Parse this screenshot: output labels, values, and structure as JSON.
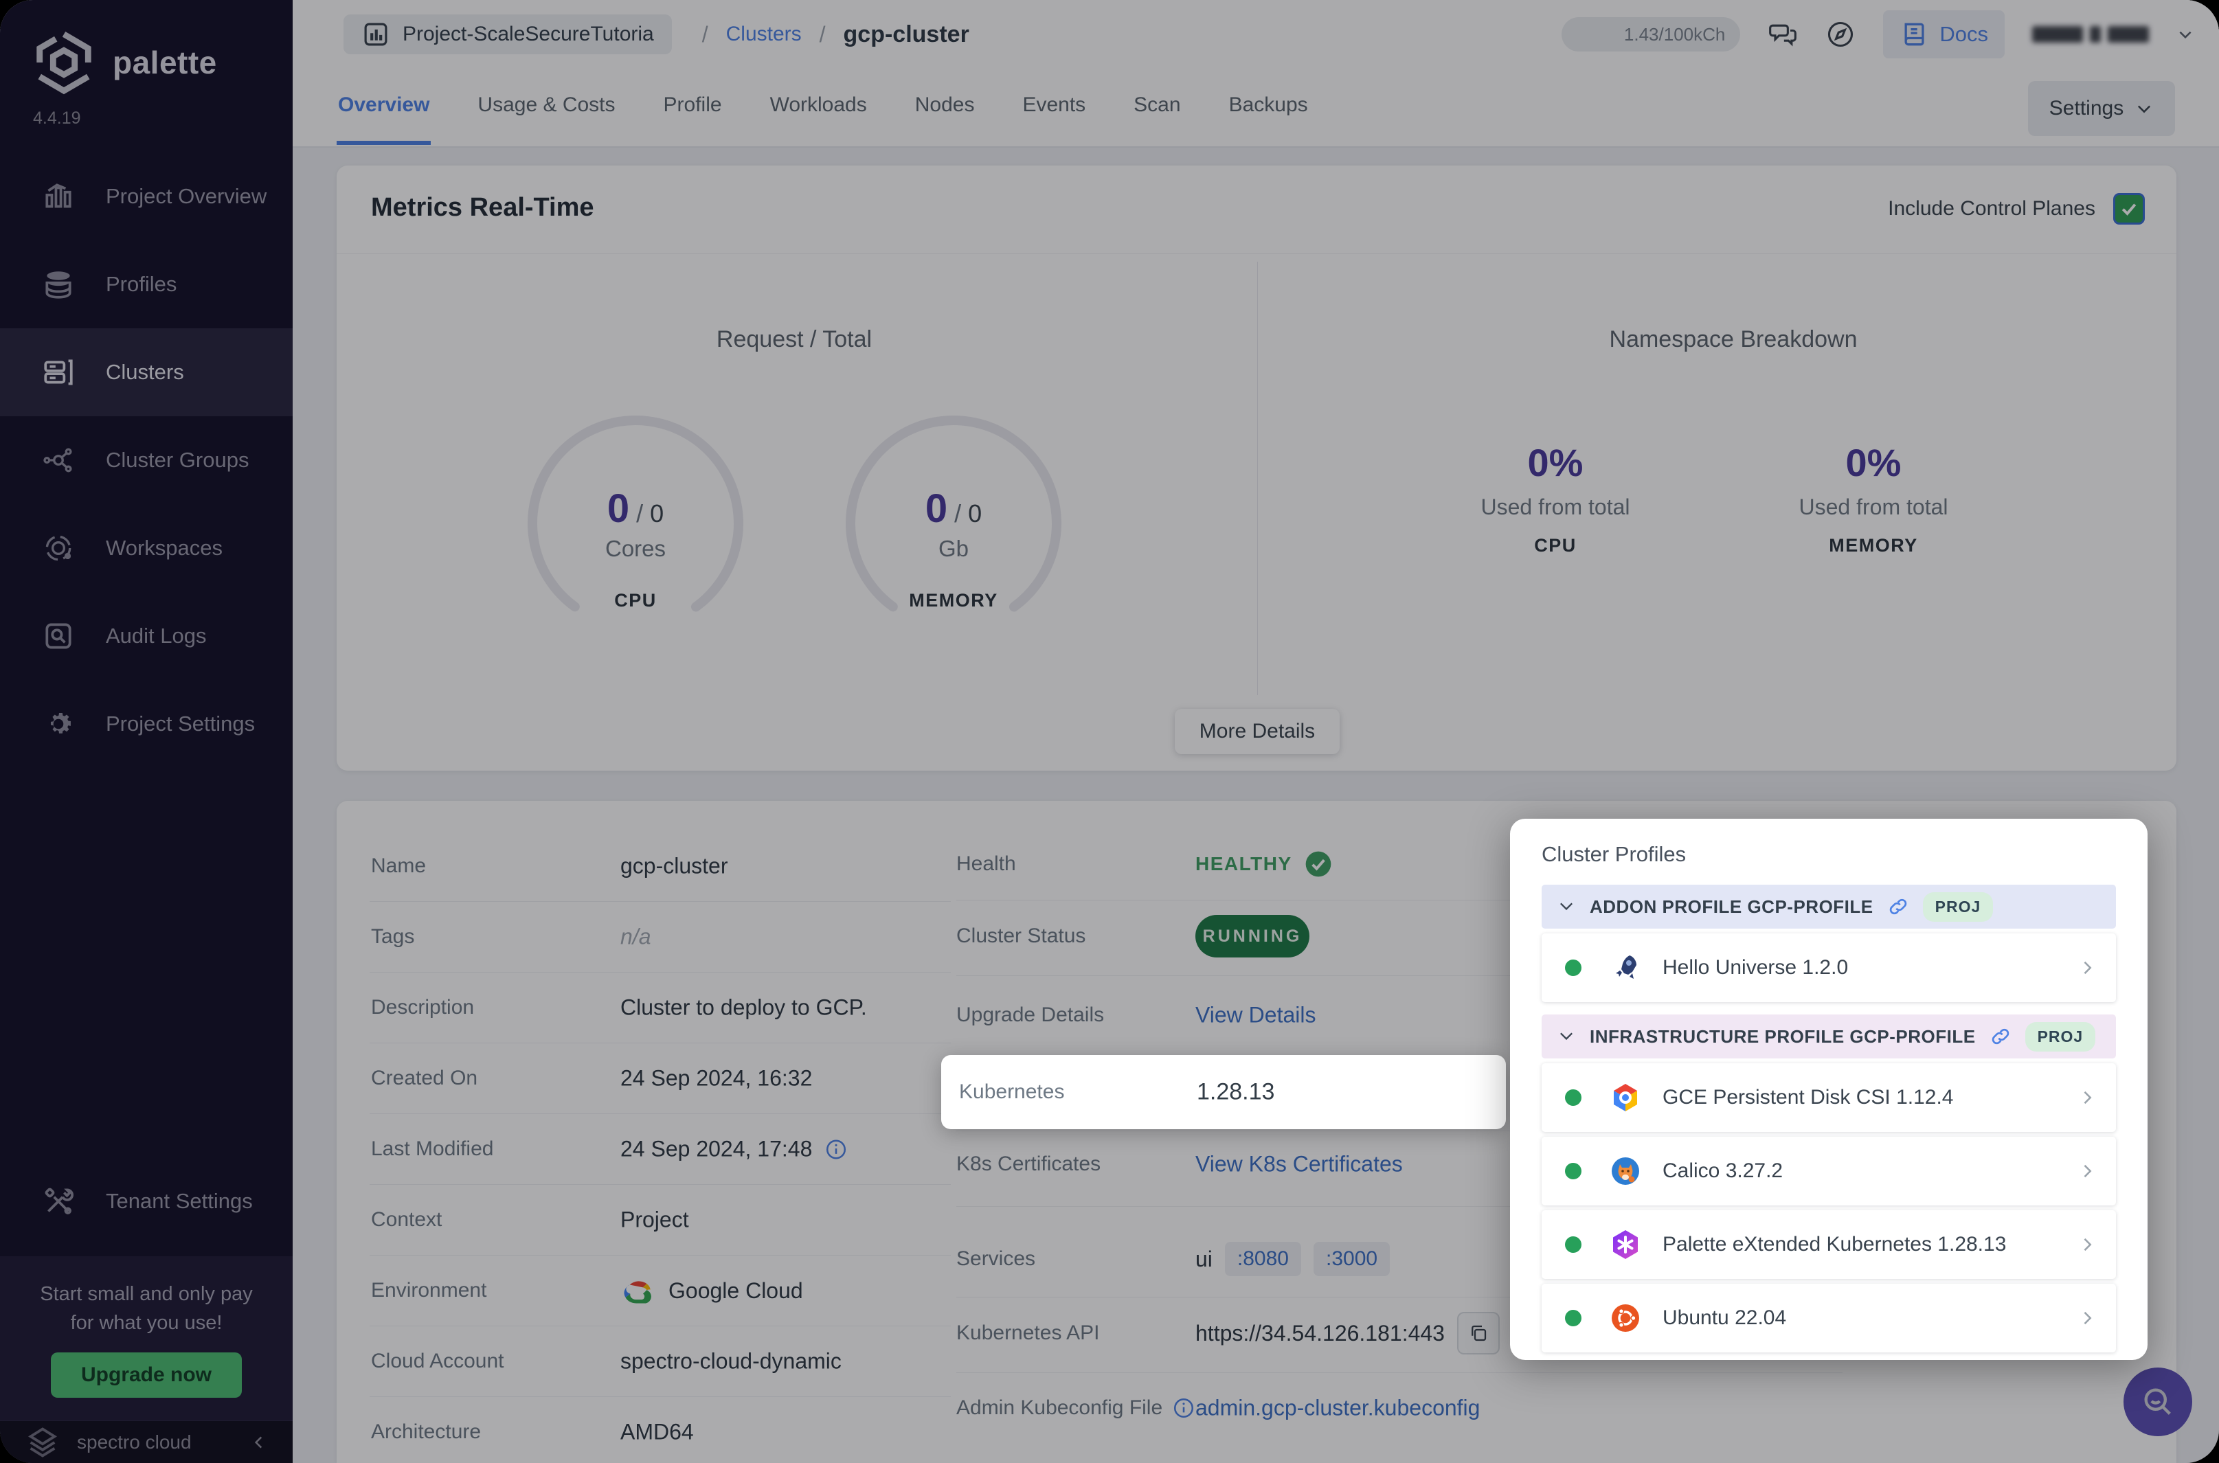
{
  "colors": {
    "accent-blue": "#4e82e4",
    "link-blue": "#3c6fc4",
    "green": "#3f9e63",
    "running-green": "#1e7a47",
    "purple": "#4a3a9c",
    "fab-purple": "#5b4fb5",
    "sidebar-bg": "#151229",
    "upgrade-green": "#4dbd73"
  },
  "app": {
    "logo_text": "palette",
    "version": "4.4.19"
  },
  "sidebar": {
    "items": [
      {
        "label": "Project Overview"
      },
      {
        "label": "Profiles"
      },
      {
        "label": "Clusters"
      },
      {
        "label": "Cluster Groups"
      },
      {
        "label": "Workspaces"
      },
      {
        "label": "Audit Logs"
      },
      {
        "label": "Project Settings"
      }
    ],
    "tenant_settings": "Tenant Settings",
    "promo": {
      "line1": "Start small and only pay",
      "line2": "for what you use!",
      "button": "Upgrade now"
    },
    "brand": "spectro cloud"
  },
  "topbar": {
    "project": "Project-ScaleSecureTutoria",
    "sep1": "/",
    "sep2": "/",
    "crumb_link": "Clusters",
    "crumb_current": "gcp-cluster",
    "usage": "1.43/100kCh",
    "docs": "Docs"
  },
  "tabs": {
    "items": [
      {
        "label": "Overview"
      },
      {
        "label": "Usage & Costs"
      },
      {
        "label": "Profile"
      },
      {
        "label": "Workloads"
      },
      {
        "label": "Nodes"
      },
      {
        "label": "Events"
      },
      {
        "label": "Scan"
      },
      {
        "label": "Backups"
      }
    ],
    "settings": "Settings"
  },
  "metrics": {
    "title": "Metrics Real-Time",
    "include_control_planes": "Include Control Planes",
    "request_total_title": "Request / Total",
    "cpu": {
      "used": "0",
      "divider": "/",
      "total": "0",
      "unit": "Cores",
      "label": "CPU"
    },
    "memory": {
      "used": "0",
      "divider": "/",
      "total": "0",
      "unit": "Gb",
      "label": "MEMORY"
    },
    "namespace_title": "Namespace Breakdown",
    "ns_cpu": {
      "percent": "0%",
      "caption": "Used from total",
      "label": "CPU"
    },
    "ns_memory": {
      "percent": "0%",
      "caption": "Used from total",
      "label": "MEMORY"
    },
    "more_details": "More Details"
  },
  "details": {
    "left": [
      {
        "label": "Name",
        "value": "gcp-cluster"
      },
      {
        "label": "Tags",
        "value": "n/a"
      },
      {
        "label": "Description",
        "value": "Cluster to deploy to GCP."
      },
      {
        "label": "Created On",
        "value": "24 Sep 2024, 16:32"
      },
      {
        "label": "Last Modified",
        "value": "24 Sep 2024, 17:48"
      },
      {
        "label": "Context",
        "value": "Project"
      },
      {
        "label": "Environment",
        "value": "Google Cloud"
      },
      {
        "label": "Cloud Account",
        "value": "spectro-cloud-dynamic"
      },
      {
        "label": "Architecture",
        "value": "AMD64"
      }
    ],
    "right": {
      "health_label": "Health",
      "health_value": "HEALTHY",
      "status_label": "Cluster Status",
      "status_value": "RUNNING",
      "upgrade_label": "Upgrade Details",
      "upgrade_value": "View Details",
      "kubernetes_label": "Kubernetes",
      "kubernetes_value": "1.28.13",
      "certs_label": "K8s Certificates",
      "certs_value": "View K8s Certificates",
      "services_label": "Services",
      "services_ui": "ui",
      "services_ports": [
        ":8080",
        ":3000"
      ],
      "api_label": "Kubernetes API",
      "api_value": "https://34.54.126.181:443",
      "kubeconfig_label": "Admin Kubeconfig File",
      "kubeconfig_value": "admin.gcp-cluster.kubeconfig"
    }
  },
  "popup": {
    "title": "Cluster Profiles",
    "sections": [
      {
        "header": "ADDON PROFILE GCP-PROFILE",
        "badge": "PROJ",
        "items": [
          {
            "name": "Hello Universe 1.2.0"
          }
        ]
      },
      {
        "header": "INFRASTRUCTURE PROFILE GCP-PROFILE",
        "badge": "PROJ",
        "items": [
          {
            "name": "GCE Persistent Disk CSI 1.12.4"
          },
          {
            "name": "Calico 3.27.2"
          },
          {
            "name": "Palette eXtended Kubernetes 1.28.13"
          },
          {
            "name": "Ubuntu 22.04"
          }
        ]
      }
    ]
  }
}
